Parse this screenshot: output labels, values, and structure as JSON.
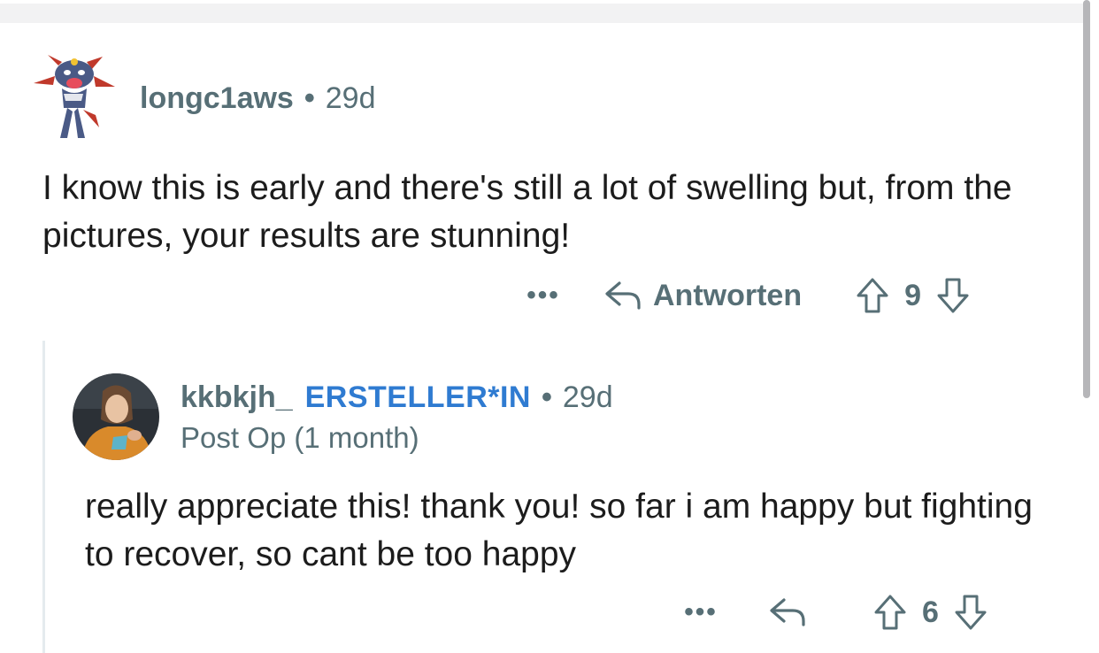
{
  "comment": {
    "author": "longc1aws",
    "separator": "•",
    "age": "29d",
    "avatar_icon": "cartoon-avatar-icon",
    "body": "I know this is early and there's still a lot of swelling but, from the pictures, your results are stunning!",
    "actions": {
      "more_label": "•••",
      "reply_label": "Antworten",
      "score": "9"
    }
  },
  "reply": {
    "author": "kkbkjh_",
    "op_badge": "ERSTELLER*IN",
    "separator": "•",
    "age": "29d",
    "flair": "Post Op (1 month)",
    "avatar_icon": "user-photo-avatar",
    "body": "really appreciate this! thank you! so far i am happy but fighting to recover, so cant be too happy",
    "actions": {
      "more_label": "•••",
      "score": "6"
    }
  },
  "colors": {
    "meta_gray": "#576f76",
    "op_blue": "#2f7bd1",
    "text": "#1c1c1c",
    "thread_line": "#e5ebee"
  }
}
